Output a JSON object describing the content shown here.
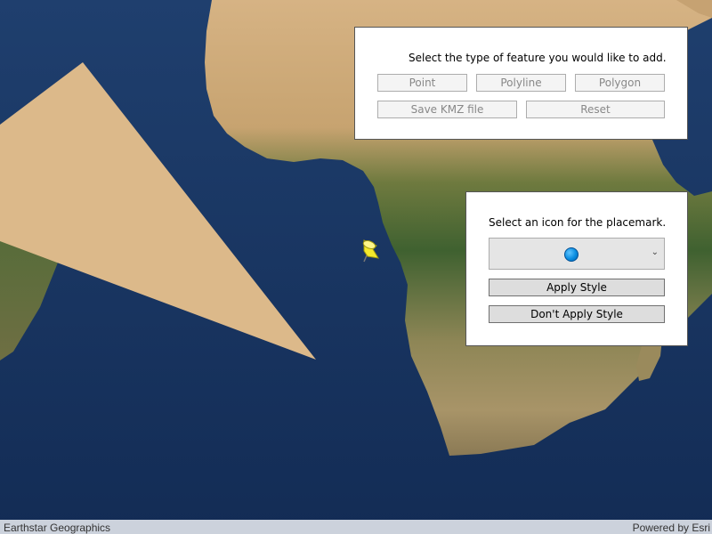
{
  "colors": {
    "ocean": "#1c3a66",
    "land_desert": "#c9a877",
    "land_forest": "#4a6b35",
    "polygon_fill": "#dcb98a",
    "pushpin": "#f3e92c"
  },
  "map": {
    "placemark_icon": "pushpin-icon",
    "attribution_left": "Earthstar Geographics",
    "attribution_right": "Powered by Esri"
  },
  "feature_panel": {
    "prompt": "Select the type of feature you would like to add.",
    "point_label": "Point",
    "polyline_label": "Polyline",
    "polygon_label": "Polygon",
    "save_label": "Save KMZ file",
    "reset_label": "Reset"
  },
  "style_panel": {
    "prompt": "Select an icon for the placemark.",
    "selected_icon": "blue-circle-icon",
    "apply_label": "Apply Style",
    "dont_apply_label": "Don't Apply Style"
  }
}
